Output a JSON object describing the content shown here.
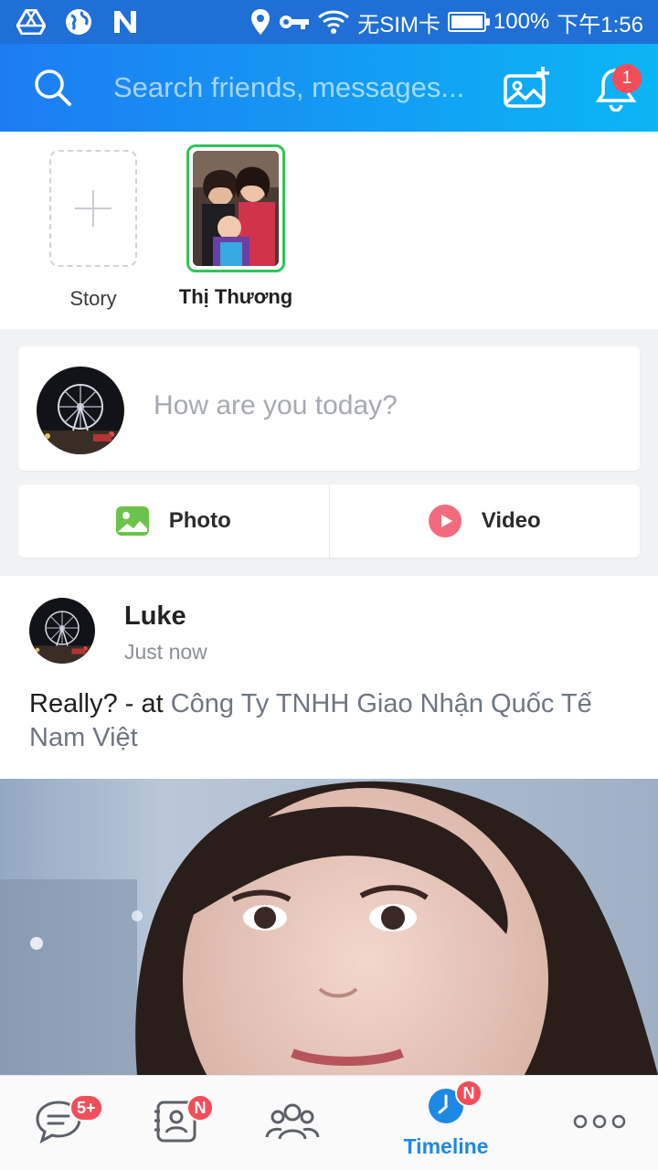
{
  "status_bar": {
    "left_icons": [
      "drive-icon",
      "globe-icon",
      "n-app-icon"
    ],
    "right_icons": [
      "location-icon",
      "vpn-key-icon",
      "wifi-icon"
    ],
    "carrier_text": "无SIM卡",
    "battery_percent_text": "100%",
    "battery_level": 1.0,
    "time_text": "下午1:56"
  },
  "header": {
    "search_placeholder": "Search friends, messages...",
    "notification_count": "1",
    "colors": {
      "gradient_start": "#1d7cf2",
      "gradient_end": "#0bb6f5"
    }
  },
  "stories": {
    "add_label": "Story",
    "friends": [
      {
        "name": "Thị Thương"
      }
    ]
  },
  "composer": {
    "prompt": "How are you today?",
    "actions": [
      {
        "label": "Photo",
        "icon": "photo-icon"
      },
      {
        "label": "Video",
        "icon": "video-play-icon"
      }
    ]
  },
  "post": {
    "author": "Luke",
    "time": "Just now",
    "text_prefix": "Really? - at ",
    "place": "Công Ty TNHH Giao Nhận Quốc Tế Nam Việt"
  },
  "bottom_nav": {
    "items": [
      {
        "name": "messages",
        "icon": "chat-icon",
        "badge": "5+"
      },
      {
        "name": "contacts",
        "icon": "contacts-icon",
        "badge": "N"
      },
      {
        "name": "groups",
        "icon": "group-icon",
        "badge": ""
      },
      {
        "name": "timeline",
        "icon": "clock-icon",
        "badge": "N",
        "label": "Timeline",
        "active": true
      },
      {
        "name": "more",
        "icon": "more-icon",
        "badge": ""
      }
    ],
    "active_color": "#1e88e5",
    "badge_color": "#f24e5a"
  }
}
